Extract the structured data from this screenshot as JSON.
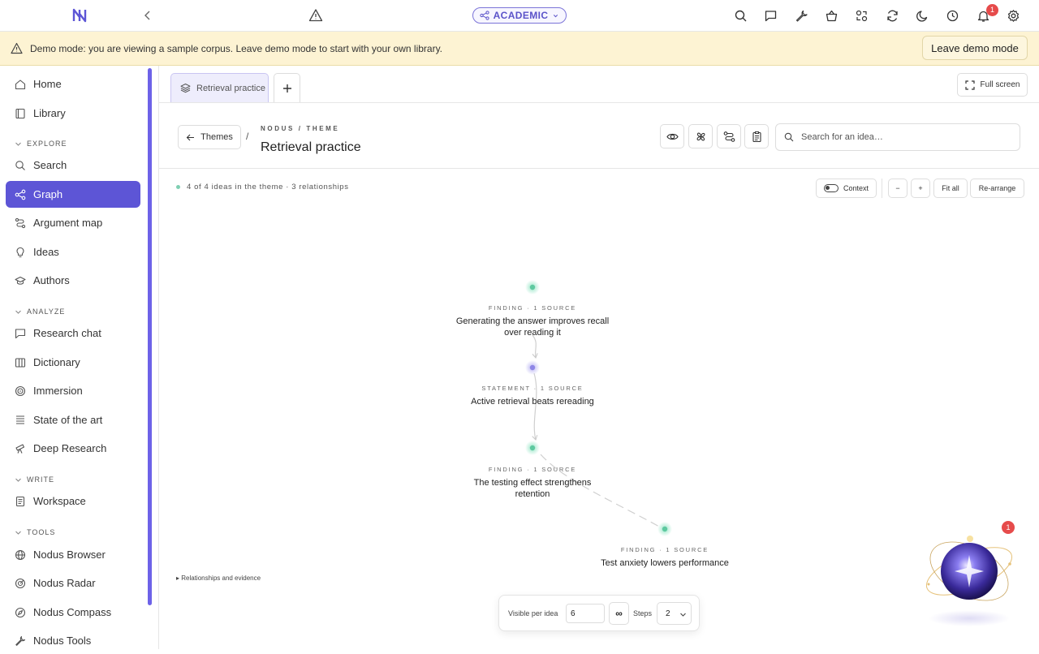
{
  "topbar": {
    "mode_label": "ACADEMIC",
    "notification_count": "1",
    "icons": [
      "search-icon",
      "message-icon",
      "wrench-icon",
      "basket-icon",
      "users-swap-icon",
      "refresh-icon",
      "moon-icon",
      "clock-icon",
      "bell-icon",
      "settings-icon"
    ]
  },
  "banner": {
    "message": "Demo mode: you are viewing a sample corpus. Leave demo mode to start with your own library.",
    "leave_label": "Leave demo mode"
  },
  "sidebar": {
    "items_top": [
      {
        "label": "Home",
        "icon": "home-icon"
      },
      {
        "label": "Library",
        "icon": "book-icon"
      }
    ],
    "sections": [
      {
        "title": "EXPLORE",
        "items": [
          {
            "label": "Search",
            "icon": "search-icon"
          },
          {
            "label": "Graph",
            "icon": "graph-icon",
            "active": true
          },
          {
            "label": "Argument map",
            "icon": "route-icon"
          },
          {
            "label": "Ideas",
            "icon": "lightbulb-icon"
          },
          {
            "label": "Authors",
            "icon": "graduation-cap-icon"
          }
        ]
      },
      {
        "title": "ANALYZE",
        "items": [
          {
            "label": "Research chat",
            "icon": "chat-icon"
          },
          {
            "label": "Dictionary",
            "icon": "dictionary-icon"
          },
          {
            "label": "Immersion",
            "icon": "target-icon"
          },
          {
            "label": "State of the art",
            "icon": "layers-icon"
          },
          {
            "label": "Deep Research",
            "icon": "telescope-icon"
          }
        ]
      },
      {
        "title": "WRITE",
        "items": [
          {
            "label": "Workspace",
            "icon": "document-icon"
          }
        ]
      },
      {
        "title": "TOOLS",
        "items": [
          {
            "label": "Nodus Browser",
            "icon": "globe-icon"
          },
          {
            "label": "Nodus Radar",
            "icon": "radar-icon"
          },
          {
            "label": "Nodus Compass",
            "icon": "compass-icon"
          },
          {
            "label": "Nodus Tools",
            "icon": "wrench-icon"
          }
        ]
      }
    ]
  },
  "tabs": {
    "items": [
      {
        "label": "Retrieval practice",
        "icon": "layers-icon"
      }
    ],
    "fullscreen_label": "Full screen"
  },
  "header": {
    "back_label": "Themes",
    "separator": "/",
    "eyebrow": "NODUS / THEME",
    "title": "Retrieval practice",
    "search_placeholder": "Search for an idea…",
    "tool_icons": [
      "eye-icon",
      "fan-icon",
      "path-icon",
      "clipboard-icon"
    ]
  },
  "canvas": {
    "status": "4 of 4 ideas in the theme · 3 relationships",
    "context_label": "Context",
    "zoom_out_label": "−",
    "zoom_in_label": "+",
    "fit_label": "Fit all",
    "rearrange_label": "Re-arrange",
    "relationships_label": "▸ Relationships and evidence",
    "nodes": [
      {
        "kind": "FINDING · 1 SOURCE",
        "text": "Generating the answer improves recall over reading it",
        "color": "#5ec9a0"
      },
      {
        "kind": "STATEMENT · 1 SOURCE",
        "text": "Active retrieval beats rereading",
        "color": "#8e86e6"
      },
      {
        "kind": "FINDING · 1 SOURCE",
        "text": "The testing effect strengthens retention",
        "color": "#5ec9a0"
      },
      {
        "kind": "FINDING · 1 SOURCE",
        "text": "Test anxiety lowers performance",
        "color": "#5ec9a0"
      }
    ],
    "controls": {
      "visible_label": "Visible per idea",
      "visible_value": "6",
      "infinity_label": "∞",
      "steps_label": "Steps",
      "steps_value": "2"
    },
    "assistant_badge": "1"
  },
  "colors": {
    "accent": "#5d55d6",
    "banner_bg": "#fdf3d3",
    "badge": "#e64b4b",
    "finding_node": "#5ec9a0",
    "statement_node": "#8e86e6"
  }
}
